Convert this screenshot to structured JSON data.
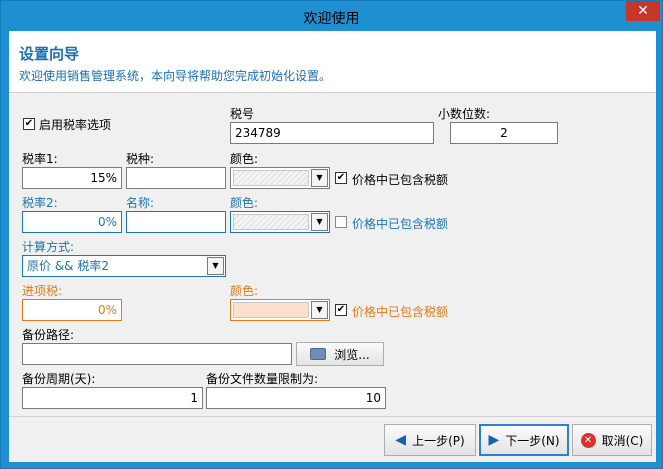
{
  "window": {
    "title": "欢迎使用",
    "close_glyph": "✕"
  },
  "header": {
    "title": "设置向导",
    "subtitle": "欢迎使用销售管理系统，本向导将帮助您完成初始化设置。"
  },
  "tax": {
    "enable_label": "启用税率选项",
    "enable_checked": true,
    "taxno_label": "税号",
    "taxno_value": "234789",
    "decimals_label": "小数位数:",
    "decimals_value": "2",
    "rate1_label": "税率1:",
    "rate1_value": "15%",
    "taxtype_label": "税种:",
    "taxtype_value": "",
    "color1_label": "颜色:",
    "include1_label": "价格中已包含税额",
    "include1_checked": true,
    "rate2_label": "税率2:",
    "rate2_value": "0%",
    "name_label": "名称:",
    "name_value": "",
    "color2_label": "颜色:",
    "include2_label": "价格中已包含税额",
    "include2_checked": false,
    "calc_label": "计算方式:",
    "calc_value": "原价 && 税率2",
    "input_tax_label": "进项税:",
    "input_tax_value": "0%",
    "color3_label": "颜色:",
    "include3_label": "价格中已包含税额",
    "include3_checked": true
  },
  "backup": {
    "path_label": "备份路径:",
    "path_value": "",
    "browse_label": "浏览...",
    "period_label": "备份周期(天):",
    "period_value": "1",
    "limit_label": "备份文件数量限制为:",
    "limit_value": "10"
  },
  "buttons": {
    "prev_label": "上一步(P)",
    "next_label": "下一步(N)",
    "cancel_label": "取消(C)"
  },
  "icons": {
    "prev": "arrow-left-icon",
    "next": "arrow-right-icon",
    "cancel": "cancel-icon",
    "browse": "folder-icon"
  },
  "colors": {
    "accent_blue": "#1c75b0",
    "accent_orange": "#e07b18",
    "title_bar": "#1e8fd0",
    "close_red": "#c7352b"
  }
}
